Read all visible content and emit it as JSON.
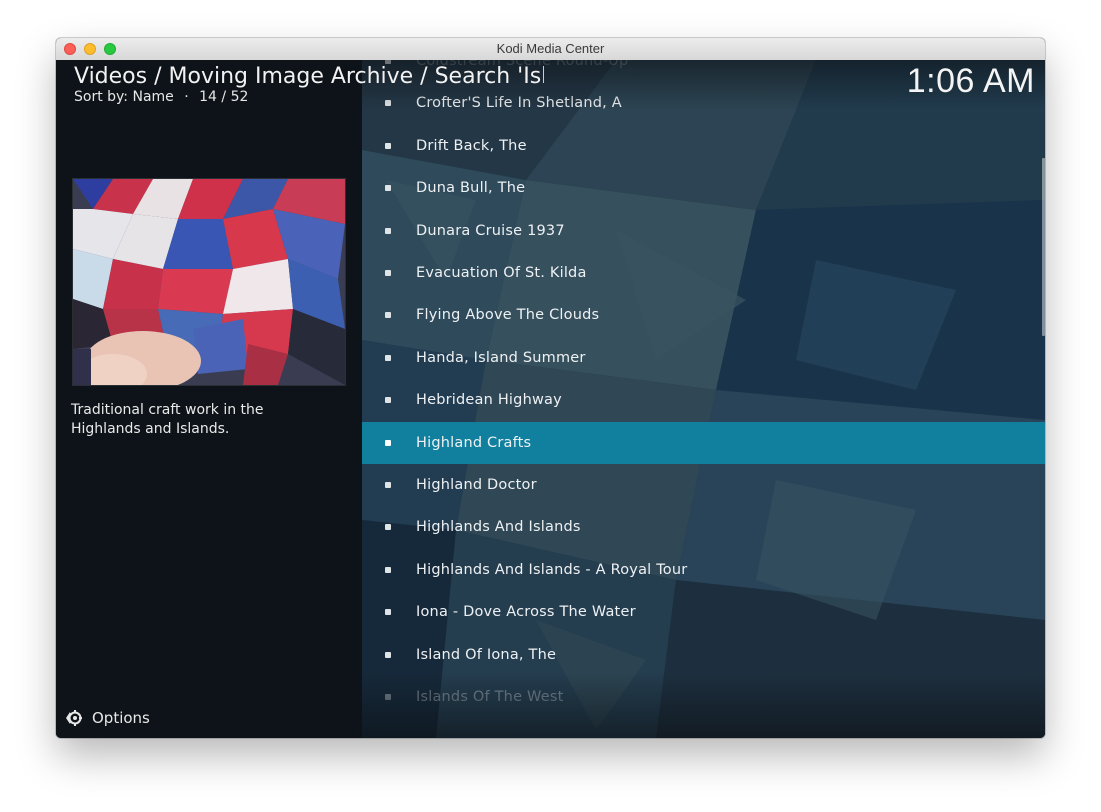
{
  "window": {
    "title": "Kodi Media Center"
  },
  "header": {
    "breadcrumb": "Videos / Moving Image Archive / Search 'Isl",
    "sort_label": "Sort by: Name",
    "separator": "·",
    "position": "14 / 52"
  },
  "clock": "1:06 AM",
  "info": {
    "plot": "Traditional craft work in the Highlands and Islands."
  },
  "options": {
    "label": "Options",
    "icon": "options-gear-icon"
  },
  "list": {
    "selected_index": 9,
    "items": [
      {
        "label": "Coldstream Scene Round-Up"
      },
      {
        "label": "Crofter'S Life In Shetland, A"
      },
      {
        "label": "Drift Back, The"
      },
      {
        "label": "Duna Bull, The"
      },
      {
        "label": "Dunara Cruise 1937"
      },
      {
        "label": "Evacuation Of St. Kilda"
      },
      {
        "label": "Flying Above The Clouds"
      },
      {
        "label": "Handa, Island Summer"
      },
      {
        "label": "Hebridean Highway"
      },
      {
        "label": "Highland Crafts"
      },
      {
        "label": "Highland Doctor"
      },
      {
        "label": "Highlands And Islands"
      },
      {
        "label": "Highlands And Islands - A Royal Tour"
      },
      {
        "label": "Iona - Dove Across The Water"
      },
      {
        "label": "Island Of Iona, The"
      },
      {
        "label": "Islands Of The West"
      }
    ]
  },
  "colors": {
    "selection": "#10809e",
    "panel": "#0d1115",
    "text": "#eef1f3"
  }
}
